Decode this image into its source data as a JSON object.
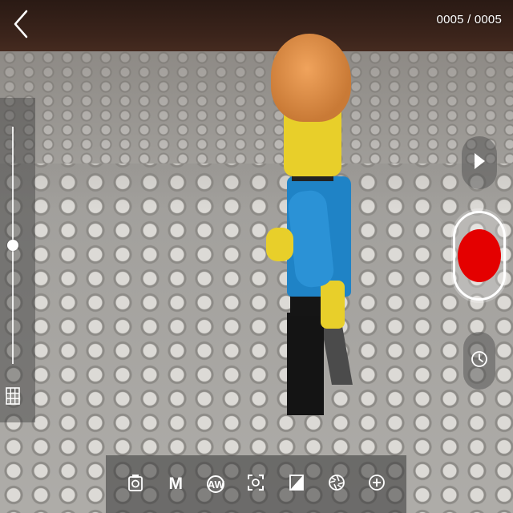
{
  "header": {
    "frame_counter": "0005 / 0005"
  },
  "icons": {
    "back": "chevron-left-icon",
    "grid": "grid-icon",
    "play": "play-icon",
    "record": "record-icon",
    "timer": "timer-icon"
  },
  "slider": {
    "level": 0.5
  },
  "toolbar": {
    "items": [
      {
        "name": "camera-icon"
      },
      {
        "name": "manual-mode",
        "label": "M"
      },
      {
        "name": "white-balance",
        "label": "AW"
      },
      {
        "name": "focus-icon"
      },
      {
        "name": "exposure-icon"
      },
      {
        "name": "aperture-icon"
      },
      {
        "name": "zoom-plus-icon"
      }
    ]
  },
  "colors": {
    "record": "#e40000",
    "overlay_text": "#ffffff"
  }
}
